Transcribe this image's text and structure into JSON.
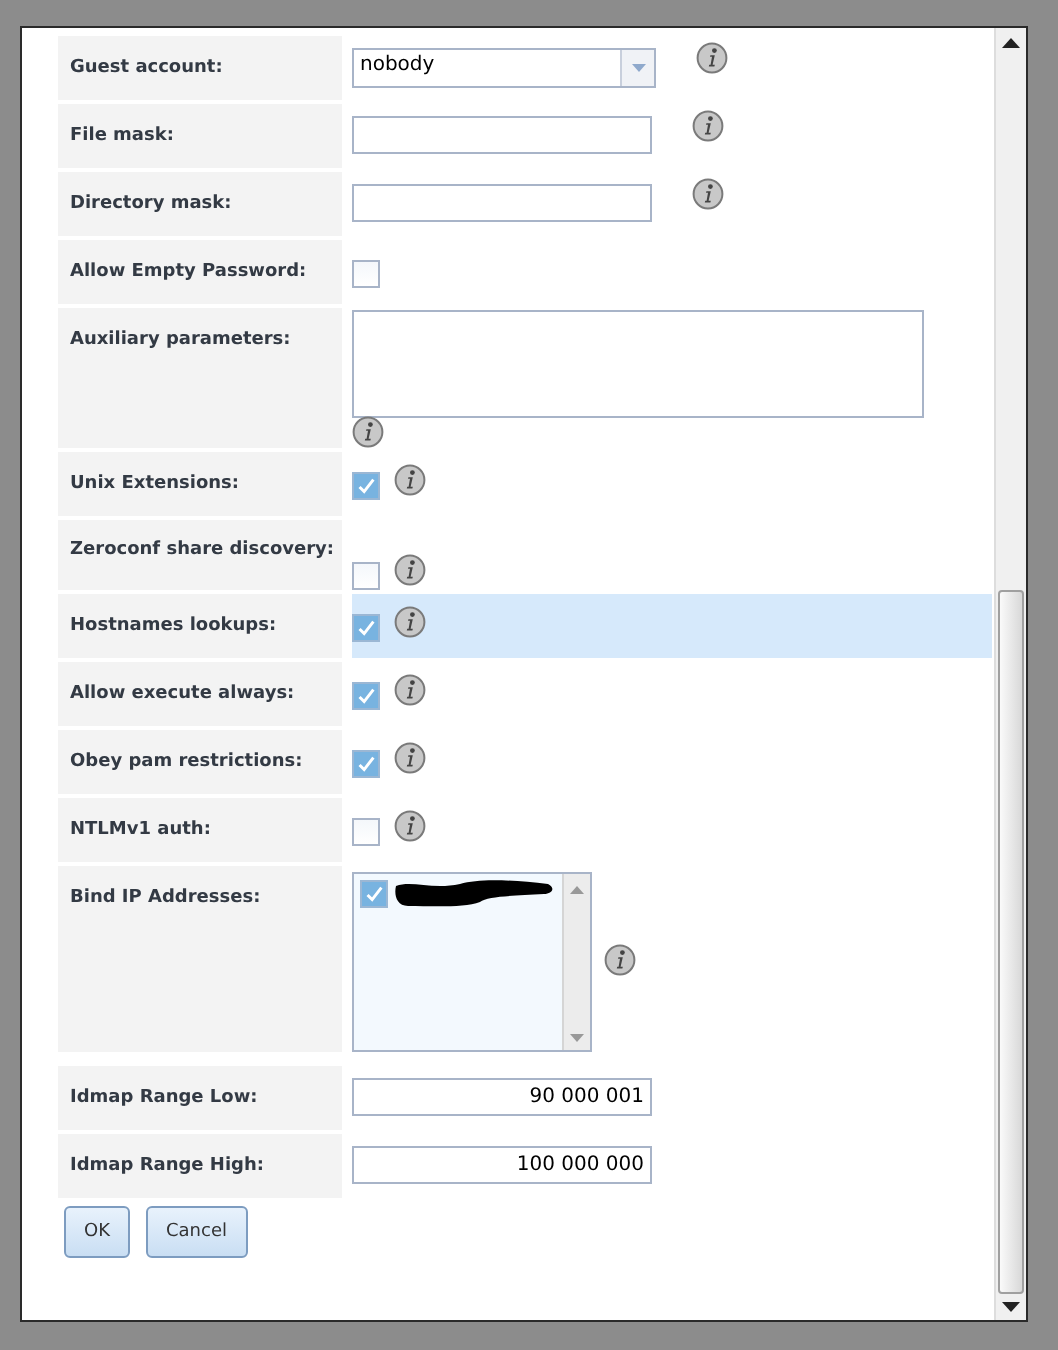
{
  "rows": [
    {
      "kind": "select",
      "label": "Guest account:",
      "value": "nobody",
      "highlighted": false
    },
    {
      "kind": "text",
      "label": "File mask:",
      "highlighted": false
    },
    {
      "kind": "text",
      "label": "Directory mask:",
      "highlighted": false
    },
    {
      "kind": "checkbox",
      "label": "Allow Empty Password:",
      "checked": false,
      "info": false,
      "highlighted": false
    },
    {
      "kind": "textarea",
      "label": "Auxiliary parameters:",
      "highlighted": false
    },
    {
      "kind": "checkbox",
      "label": "Unix Extensions:",
      "checked": true,
      "info": true,
      "highlighted": false
    },
    {
      "kind": "checkbox",
      "label": "Zeroconf share discovery:",
      "checked": false,
      "info": true,
      "highlighted": false
    },
    {
      "kind": "checkbox",
      "label": "Hostnames lookups:",
      "checked": true,
      "info": true,
      "highlighted": true
    },
    {
      "kind": "checkbox",
      "label": "Allow execute always:",
      "checked": true,
      "info": true,
      "highlighted": false
    },
    {
      "kind": "checkbox",
      "label": "Obey pam restrictions:",
      "checked": true,
      "info": true,
      "highlighted": false
    },
    {
      "kind": "checkbox",
      "label": "NTLMv1 auth:",
      "checked": false,
      "info": true,
      "highlighted": false
    },
    {
      "kind": "listbox",
      "label": "Bind IP Addresses:",
      "items": [
        {
          "checked": true
        }
      ],
      "highlighted": false
    },
    {
      "kind": "number",
      "label": "Idmap Range Low:",
      "value": "90 000 001",
      "highlighted": false
    },
    {
      "kind": "number",
      "label": "Idmap Range High:",
      "value": "100 000 000",
      "highlighted": false
    }
  ],
  "buttons": [
    "OK",
    "Cancel"
  ]
}
